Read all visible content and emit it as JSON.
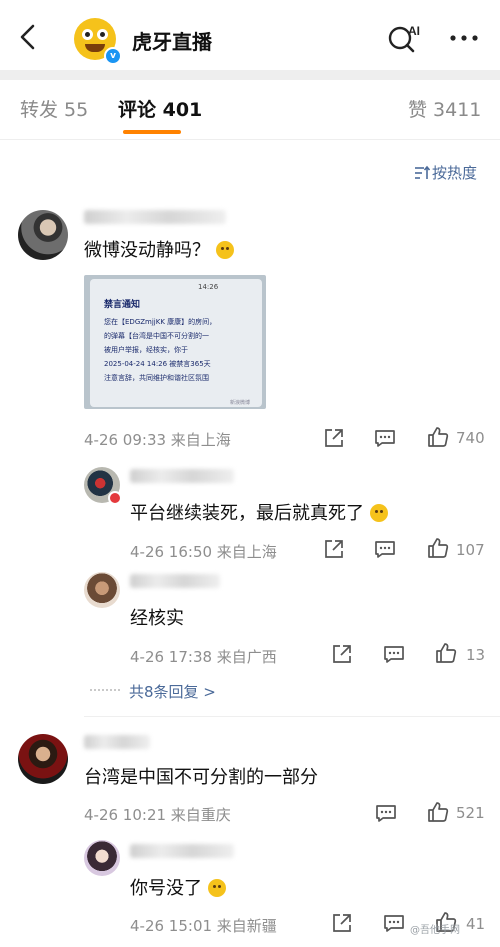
{
  "header": {
    "title": "虎牙直播"
  },
  "tabs": [
    {
      "label": "转发 55"
    },
    {
      "label": "评论 401"
    },
    {
      "label": "赞 3411"
    }
  ],
  "sort": {
    "label": "按热度"
  },
  "comments": [
    {
      "text": "微博没动静吗？",
      "image": {
        "time": "14:26",
        "heading": "禁言通知",
        "lines": [
          "您在【EDGZmjjKK 康康】的房间，",
          "的弹幕【台湾是中国不可分割的一",
          "被用户举报，经核实，你于",
          "2025-04-24 14:26 被禁言365天",
          "注意言辞，共同维护和谐社区氛围"
        ],
        "watermark": "新浪微博"
      },
      "meta": "4-26 09:33 来自上海",
      "likes": "740",
      "replies": [
        {
          "text": "平台继续装死，最后就真死了",
          "meta": "4-26 16:50 来自上海",
          "likes": "107"
        },
        {
          "text": "经核实",
          "meta": "4-26 17:38 来自广西",
          "likes": "13"
        }
      ],
      "more_replies": "共8条回复 >"
    },
    {
      "text": "台湾是中国不可分割的一部分",
      "meta": "4-26 10:21 来自重庆",
      "likes": "521",
      "replies": [
        {
          "text": "你号没了",
          "meta": "4-26 15:01 来自新疆",
          "likes": "41"
        }
      ]
    }
  ],
  "watermark": "@吾他手网",
  "colors": {
    "accent": "#ff8200",
    "link": "#4b6a99",
    "verified": "#1a95f3"
  }
}
